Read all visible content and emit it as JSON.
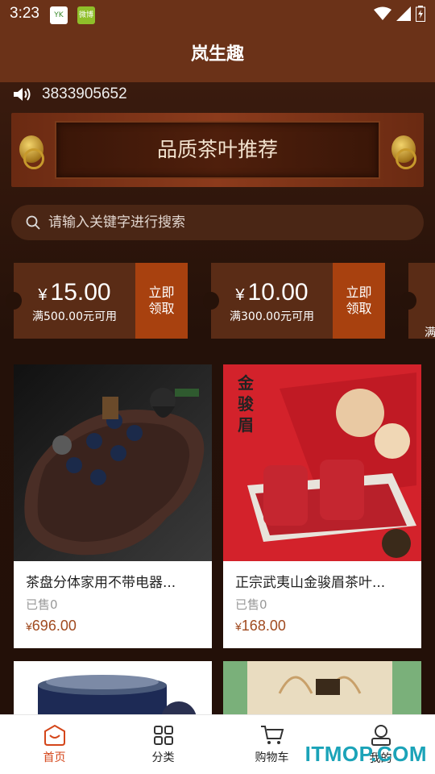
{
  "status": {
    "time": "3:23",
    "badge1": "YK",
    "badge2": "微博"
  },
  "header": {
    "title": "岚生趣"
  },
  "notice": {
    "text": "3833905652"
  },
  "banner": {
    "text": "品质茶叶推荐"
  },
  "search": {
    "placeholder": "请输入关键字进行搜索"
  },
  "coupons": [
    {
      "yen": "¥",
      "amount": "15.00",
      "condition": "满500.00元可用",
      "claim": "立即领取"
    },
    {
      "yen": "¥",
      "amount": "10.00",
      "condition": "满300.00元可用",
      "claim": "立即领取"
    },
    {
      "yen": "",
      "amount": "",
      "condition": "满",
      "claim": ""
    }
  ],
  "products": [
    {
      "name": "茶盘分体家用不带电器...",
      "sold": "已售0",
      "yen": "¥",
      "price": "696.00"
    },
    {
      "name": "正宗武夷山金骏眉茶叶...",
      "sold": "已售0",
      "yen": "¥",
      "price": "168.00",
      "box_text": "金骏眉"
    }
  ],
  "tabs": [
    {
      "label": "首页",
      "icon": "home-icon"
    },
    {
      "label": "分类",
      "icon": "category-icon"
    },
    {
      "label": "购物车",
      "icon": "cart-icon"
    },
    {
      "label": "我的",
      "icon": "user-icon"
    }
  ],
  "colors": {
    "header": "#6b3218",
    "accent": "#d4461a",
    "coupon_claim": "#a8410f",
    "price": "#a04a1f"
  },
  "watermark": "ITMOP.COM"
}
